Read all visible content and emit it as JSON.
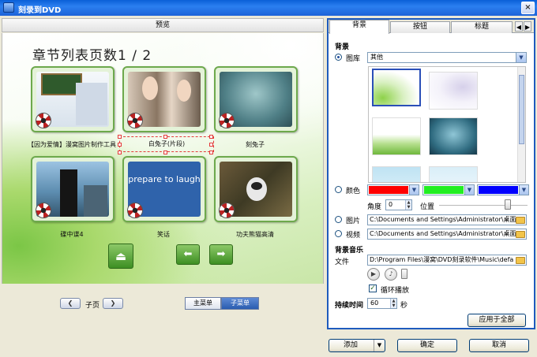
{
  "window": {
    "title": "刻录到DVD",
    "close_glyph": "×"
  },
  "preview": {
    "header": "预览",
    "page_title": "章节列表页数1 / 2",
    "thumbnails": [
      {
        "label": "【因为爱情】漫窝图片制作工具"
      },
      {
        "label": "白兔子(片段)"
      },
      {
        "label": "刻兔子"
      },
      {
        "label": "碟中谍4"
      },
      {
        "label": "笑话",
        "screen_text": "prepare to laugh"
      },
      {
        "label": "功夫熊猫高清"
      }
    ],
    "nav": {
      "eject": "⏏",
      "prev": "⬅",
      "next": "➡"
    }
  },
  "subpage": {
    "label": "子页",
    "prev": "❮",
    "next": "❯"
  },
  "menu_tabs": {
    "main": "主菜单",
    "sub": "子菜单"
  },
  "settings": {
    "tabs": [
      "背景",
      "按钮",
      "标题"
    ],
    "tab_arrows": [
      "◀",
      "▶"
    ],
    "background": {
      "section_title": "背景",
      "gallery_label": "图库",
      "gallery_value": "其他",
      "color_label": "颜色",
      "colors": [
        "#ff0000",
        "#22ee22",
        "#0000ff"
      ],
      "angle_label": "角度",
      "angle_value": "0",
      "position_label": "位置",
      "position_level": 0.78,
      "picture_label": "图片",
      "picture_path": "C:\\Documents and Settings\\Administrator\\桌面",
      "video_label": "视频",
      "video_path": "C:\\Documents and Settings\\Administrator\\桌面"
    },
    "music": {
      "section_title": "背景音乐",
      "file_label": "文件",
      "file_path": "D:\\Program Files\\漫窝\\DVD刻录软件\\Music\\defa",
      "loop_label": "循环播放",
      "loop_checked": true
    },
    "duration": {
      "label": "持续时间",
      "value": "60",
      "unit": "秒"
    },
    "apply_all": "应用于全部"
  },
  "footer": {
    "add": "添加",
    "ok": "确定",
    "cancel": "取消"
  }
}
